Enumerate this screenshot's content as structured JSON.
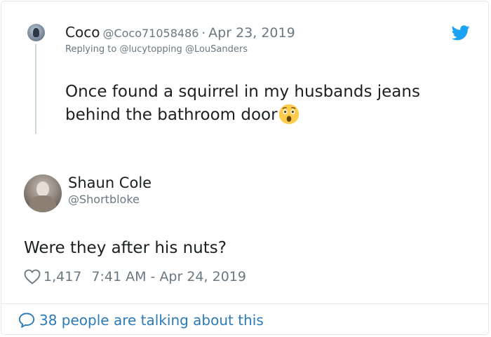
{
  "parent_tweet": {
    "name": "Coco",
    "handle": "@Coco71058486",
    "separator": "·",
    "date": "Apr 23, 2019",
    "replying_prefix": "Replying to ",
    "mention_1": "@lucytopping",
    "mention_2": "@LouSanders",
    "text": "Once found a squirrel in my husbands jeans behind the bathroom door",
    "emoji": "astonished-face-emoji"
  },
  "reply_tweet": {
    "name": "Shaun Cole",
    "handle": "@Shortbloke",
    "text": "Were they after his nuts?",
    "likes": "1,417",
    "timestamp": "7:41 AM - Apr 24, 2019"
  },
  "footer": {
    "talking_text": "38 people are talking about this"
  },
  "icons": {
    "brand": "twitter-bird-icon",
    "like": "heart-icon",
    "conversation": "speech-bubble-icon"
  },
  "colors": {
    "twitter_blue": "#1da1f2",
    "link_blue": "#2b7bb9",
    "secondary_text": "#697882",
    "primary_text": "#1c2022",
    "border": "#e1e8ed"
  }
}
